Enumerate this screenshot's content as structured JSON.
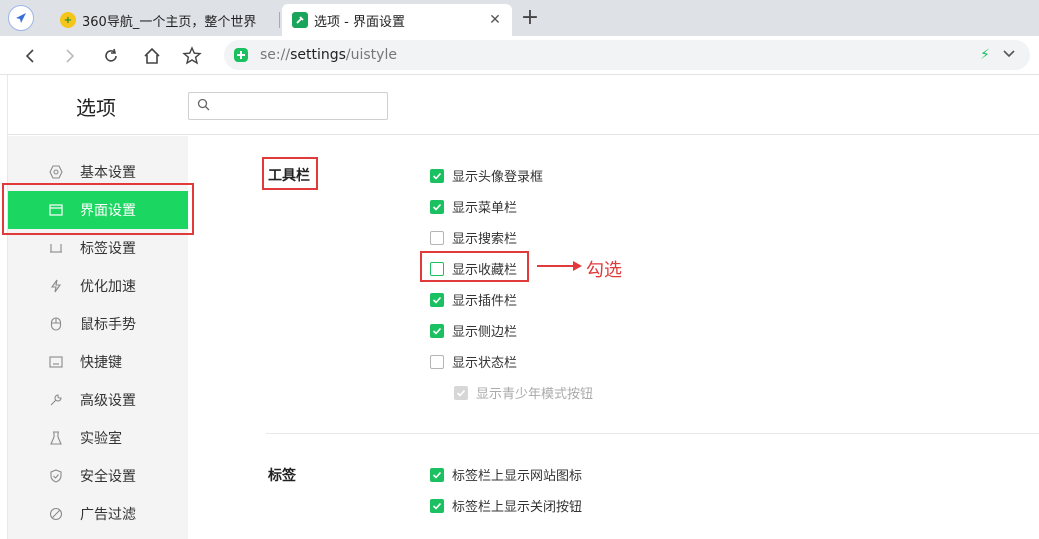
{
  "tabs": [
    {
      "title": "360导航_一个主页，整个世界",
      "icon": "360-favicon"
    },
    {
      "title": "选项 - 界面设置",
      "icon": "settings-favicon"
    }
  ],
  "address": {
    "scheme": "se://",
    "host": "settings",
    "path": "/uistyle"
  },
  "header": {
    "title": "选项",
    "search_placeholder": ""
  },
  "sidebar": {
    "items": [
      {
        "label": "基本设置",
        "icon": "hexagon-icon"
      },
      {
        "label": "界面设置",
        "icon": "window-icon"
      },
      {
        "label": "标签设置",
        "icon": "tab-icon"
      },
      {
        "label": "优化加速",
        "icon": "bolt-icon"
      },
      {
        "label": "鼠标手势",
        "icon": "mouse-icon"
      },
      {
        "label": "快捷键",
        "icon": "keyboard-icon"
      },
      {
        "label": "高级设置",
        "icon": "wrench-icon"
      },
      {
        "label": "实验室",
        "icon": "flask-icon"
      },
      {
        "label": "安全设置",
        "icon": "shield-icon"
      },
      {
        "label": "广告过滤",
        "icon": "block-icon"
      }
    ]
  },
  "toolbar_section": {
    "label": "工具栏",
    "options": [
      {
        "label": "显示头像登录框",
        "checked": true
      },
      {
        "label": "显示菜单栏",
        "checked": true
      },
      {
        "label": "显示搜索栏",
        "checked": false
      },
      {
        "label": "显示收藏栏",
        "checked": false
      },
      {
        "label": "显示插件栏",
        "checked": true
      },
      {
        "label": "显示侧边栏",
        "checked": true
      },
      {
        "label": "显示状态栏",
        "checked": false
      },
      {
        "label": "显示青少年模式按钮",
        "checked": true,
        "disabled": true
      }
    ]
  },
  "tabs_section": {
    "label": "标签",
    "options": [
      {
        "label": "标签栏上显示网站图标",
        "checked": true
      },
      {
        "label": "标签栏上显示关闭按钮",
        "checked": true
      }
    ]
  },
  "annotation": {
    "text": "勾选"
  },
  "colors": {
    "accent": "#1bd660",
    "check": "#1bc161",
    "highlight": "#e03a3a"
  }
}
